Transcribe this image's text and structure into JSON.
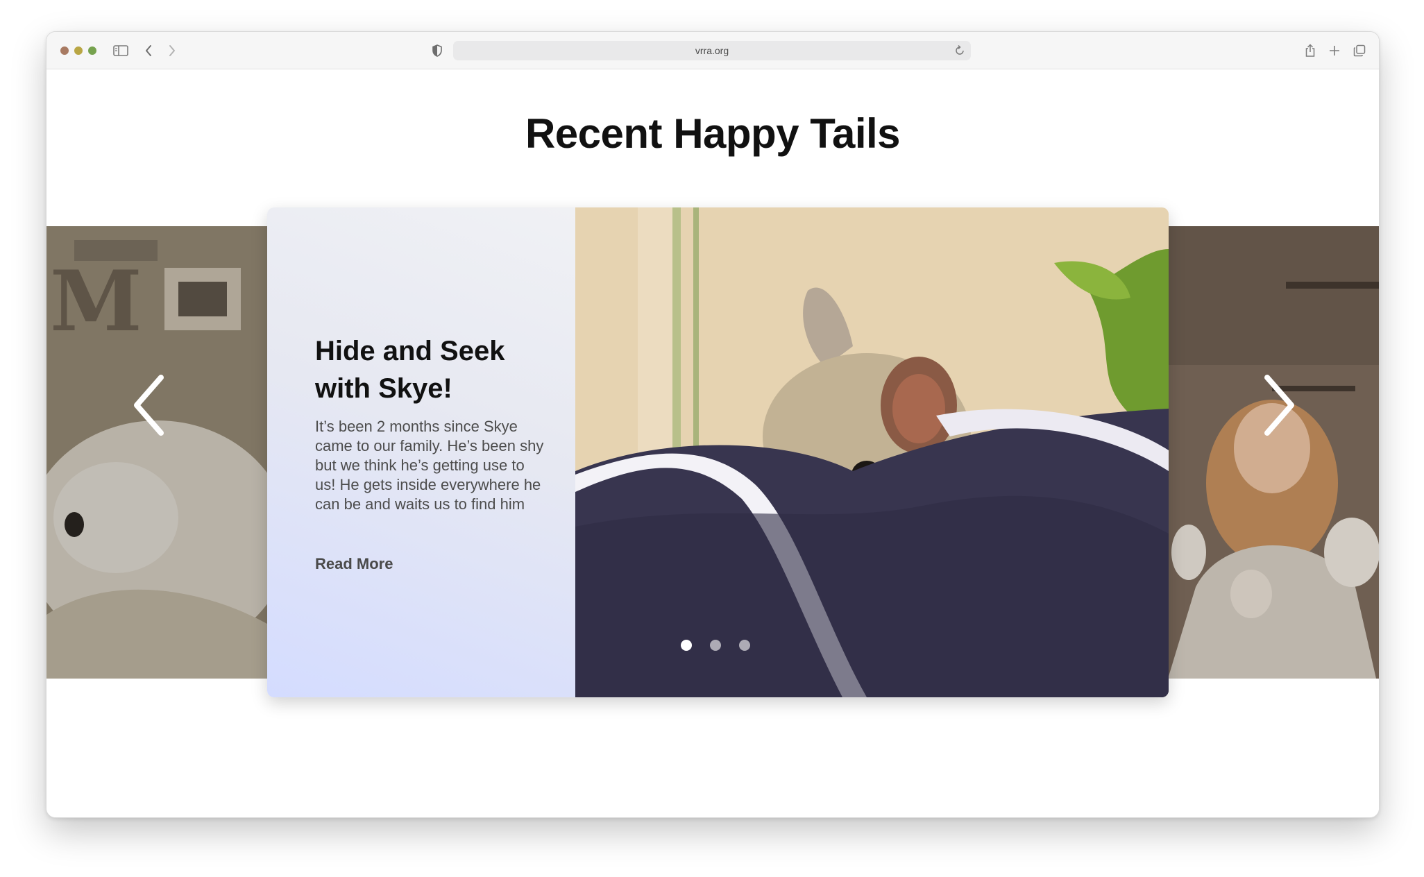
{
  "browser": {
    "url": "vrra.org",
    "traffic_colors": [
      "#a87a62",
      "#b9a644",
      "#76a24e"
    ]
  },
  "page": {
    "heading": "Recent Happy Tails"
  },
  "carousel": {
    "active_slide": {
      "title": "Hide and Seek with Skye!",
      "body": "It’s been 2 months since Skye came to our family. He’s been shy but we think he’s getting use to us! He gets inside everywhere he can be and waits us to find him",
      "read_more": "Read More"
    },
    "indicator_count": 3,
    "active_index": 0
  },
  "icons": {
    "sidebar": "sidebar-icon",
    "back": "chevron-left-icon",
    "forward": "chevron-right-icon",
    "privacy": "shield-icon",
    "reload": "reload-icon",
    "share": "share-icon",
    "new_tab": "plus-icon",
    "tabs": "tabs-icon",
    "prev": "carousel-prev-icon",
    "next": "carousel-next-icon"
  }
}
